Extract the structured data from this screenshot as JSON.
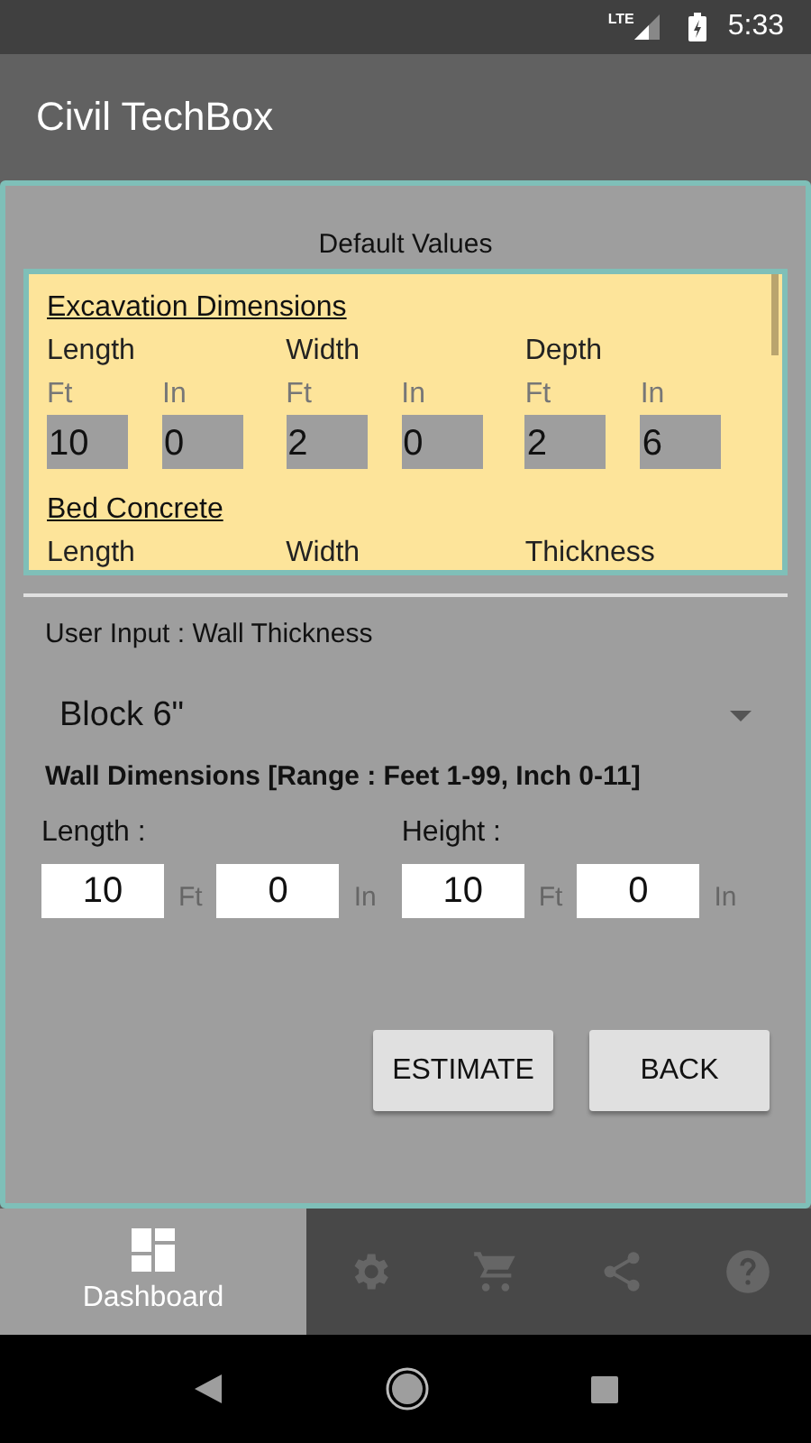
{
  "status_bar": {
    "network": "LTE",
    "time": "5:33"
  },
  "app_bar": {
    "title": "Civil TechBox"
  },
  "defaults": {
    "title": "Default Values",
    "sections": [
      {
        "heading": "Excavation Dimensions",
        "groups": [
          {
            "label": "Length",
            "fields": [
              {
                "unit": "Ft",
                "value": "10"
              },
              {
                "unit": "In",
                "value": "0"
              }
            ]
          },
          {
            "label": "Width",
            "fields": [
              {
                "unit": "Ft",
                "value": "2"
              },
              {
                "unit": "In",
                "value": "0"
              }
            ]
          },
          {
            "label": "Depth",
            "fields": [
              {
                "unit": "Ft",
                "value": "2"
              },
              {
                "unit": "In",
                "value": "6"
              }
            ]
          }
        ]
      },
      {
        "heading": "Bed Concrete",
        "groups": [
          {
            "label": "Length"
          },
          {
            "label": "Width"
          },
          {
            "label": "Thickness"
          }
        ]
      }
    ]
  },
  "wall_thickness": {
    "label": "User Input : Wall Thickness",
    "value": "Block 6\""
  },
  "wall_dimensions": {
    "label": "Wall Dimensions [Range : Feet 1-99, Inch 0-11]",
    "groups": [
      {
        "label": "Length :",
        "fields": [
          {
            "value": "10",
            "unit": "Ft"
          },
          {
            "value": "0",
            "unit": "In"
          }
        ]
      },
      {
        "label": "Height :",
        "fields": [
          {
            "value": "10",
            "unit": "Ft"
          },
          {
            "value": "0",
            "unit": "In"
          }
        ]
      }
    ]
  },
  "buttons": [
    "ESTIMATE",
    "BACK"
  ],
  "bottom_nav": [
    {
      "kind": "dashboard",
      "label": "Dashboard",
      "selected": true
    },
    {
      "kind": "settings",
      "selected": false
    },
    {
      "kind": "cart",
      "selected": false
    },
    {
      "kind": "share",
      "selected": false
    },
    {
      "kind": "help",
      "selected": false
    }
  ]
}
